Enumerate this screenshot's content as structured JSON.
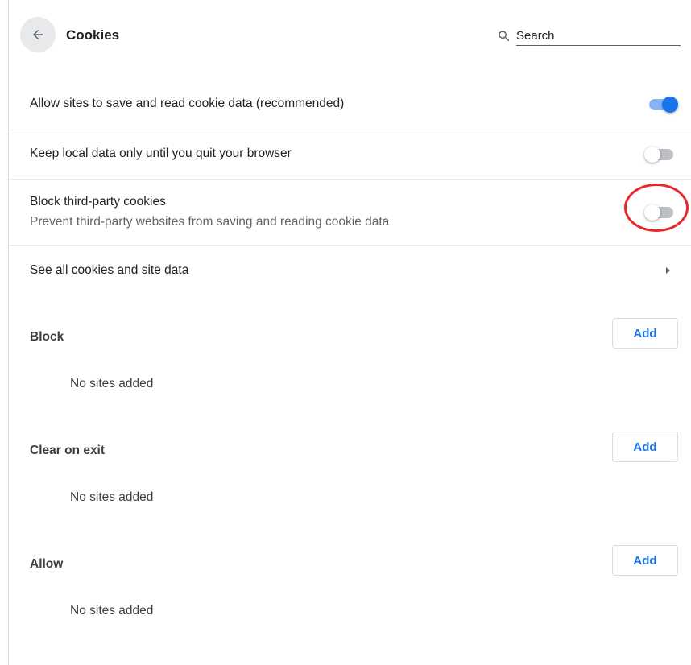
{
  "header": {
    "title": "Cookies",
    "search_placeholder": "Search"
  },
  "settings": [
    {
      "label": "Allow sites to save and read cookie data (recommended)",
      "enabled": true
    },
    {
      "label": "Keep local data only until you quit your browser",
      "enabled": false
    },
    {
      "label": "Block third-party cookies",
      "sublabel": "Prevent third-party websites from saving and reading cookie data",
      "enabled": false
    }
  ],
  "see_all": {
    "label": "See all cookies and site data"
  },
  "sections": [
    {
      "title": "Block",
      "add_label": "Add",
      "empty_text": "No sites added"
    },
    {
      "title": "Clear on exit",
      "add_label": "Add",
      "empty_text": "No sites added"
    },
    {
      "title": "Allow",
      "add_label": "Add",
      "empty_text": "No sites added"
    }
  ],
  "colors": {
    "accent": "#1a73e8",
    "highlight": "#e8262b"
  },
  "icons": {
    "back": "arrow-back-icon",
    "search": "search-icon",
    "chevron": "chevron-right-icon"
  }
}
